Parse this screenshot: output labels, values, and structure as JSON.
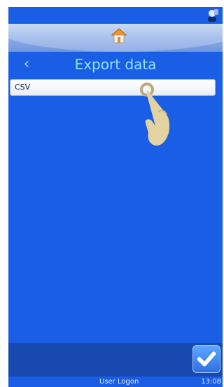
{
  "header": {
    "title": "Export data"
  },
  "list": {
    "items": [
      {
        "label": "CSV"
      }
    ]
  },
  "footer": {
    "user_label": "User Logon",
    "time": "13:08"
  }
}
